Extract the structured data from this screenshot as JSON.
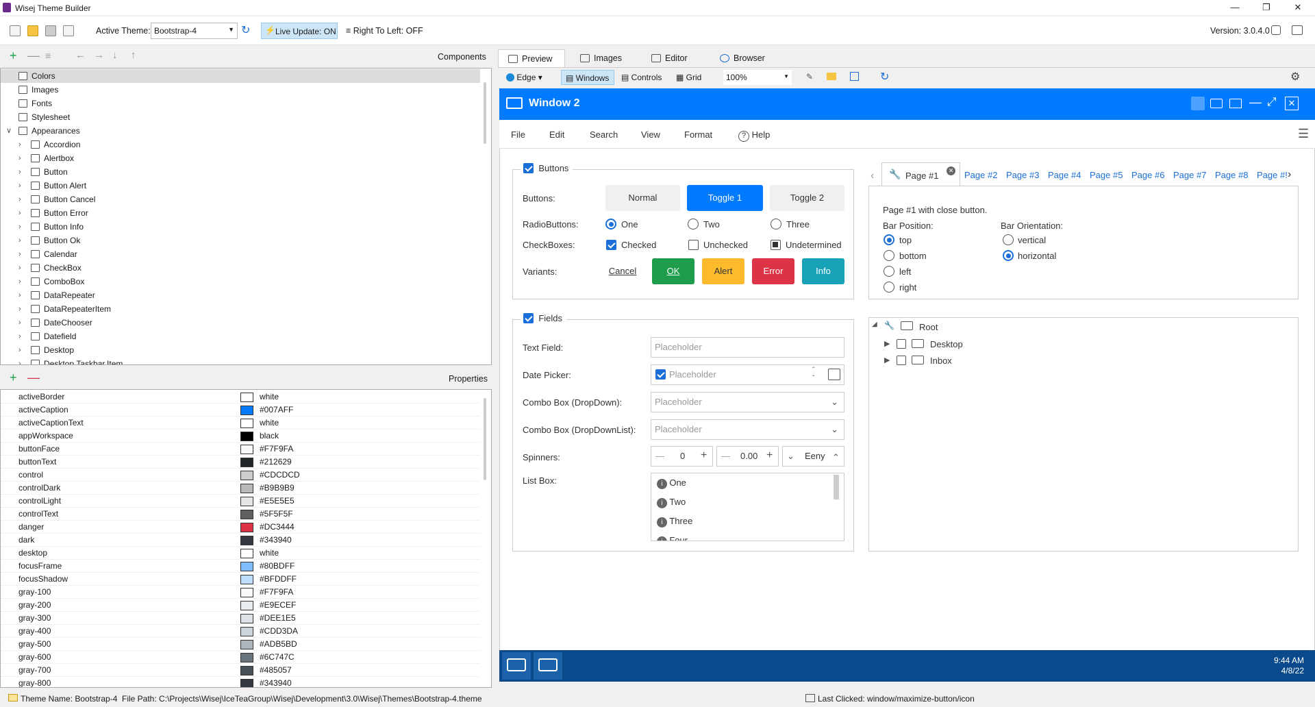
{
  "app": {
    "title": "Wisej Theme Builder",
    "version": "Version: 3.0.4.0"
  },
  "toolbar": {
    "active_theme_label": "Active Theme:",
    "active_theme_value": "Bootstrap-4",
    "live_update": "Live Update: ON",
    "rtl": "Right To Left: OFF"
  },
  "components": {
    "header": "Components",
    "items": [
      {
        "label": "Colors",
        "level": 0,
        "expandable": false,
        "selected": true
      },
      {
        "label": "Images",
        "level": 0,
        "expandable": false
      },
      {
        "label": "Fonts",
        "level": 0,
        "expandable": false
      },
      {
        "label": "Stylesheet",
        "level": 0,
        "expandable": false
      },
      {
        "label": "Appearances",
        "level": 0,
        "expandable": true,
        "expanded": true
      },
      {
        "label": "Accordion",
        "level": 1,
        "expandable": true
      },
      {
        "label": "Alertbox",
        "level": 1,
        "expandable": true
      },
      {
        "label": "Button",
        "level": 1,
        "expandable": true
      },
      {
        "label": "Button Alert",
        "level": 1,
        "expandable": true
      },
      {
        "label": "Button Cancel",
        "level": 1,
        "expandable": true
      },
      {
        "label": "Button Error",
        "level": 1,
        "expandable": true
      },
      {
        "label": "Button Info",
        "level": 1,
        "expandable": true
      },
      {
        "label": "Button Ok",
        "level": 1,
        "expandable": true
      },
      {
        "label": "Calendar",
        "level": 1,
        "expandable": true
      },
      {
        "label": "CheckBox",
        "level": 1,
        "expandable": true
      },
      {
        "label": "ComboBox",
        "level": 1,
        "expandable": true
      },
      {
        "label": "DataRepeater",
        "level": 1,
        "expandable": true
      },
      {
        "label": "DataRepeaterItem",
        "level": 1,
        "expandable": true
      },
      {
        "label": "DateChooser",
        "level": 1,
        "expandable": true
      },
      {
        "label": "Datefield",
        "level": 1,
        "expandable": true
      },
      {
        "label": "Desktop",
        "level": 1,
        "expandable": true
      },
      {
        "label": "Desktop.Taskbar.Item",
        "level": 1,
        "expandable": true
      }
    ]
  },
  "properties": {
    "header": "Properties",
    "rows": [
      {
        "name": "activeBorder",
        "color": "#FFFFFF",
        "value": "white"
      },
      {
        "name": "activeCaption",
        "color": "#007AFF",
        "value": "#007AFF"
      },
      {
        "name": "activeCaptionText",
        "color": "#FFFFFF",
        "value": "white"
      },
      {
        "name": "appWorkspace",
        "color": "#000000",
        "value": "black"
      },
      {
        "name": "buttonFace",
        "color": "#F7F9FA",
        "value": "#F7F9FA"
      },
      {
        "name": "buttonText",
        "color": "#212629",
        "value": "#212629"
      },
      {
        "name": "control",
        "color": "#CDCDCD",
        "value": "#CDCDCD"
      },
      {
        "name": "controlDark",
        "color": "#B9B9B9",
        "value": "#B9B9B9"
      },
      {
        "name": "controlLight",
        "color": "#E5E5E5",
        "value": "#E5E5E5"
      },
      {
        "name": "controlText",
        "color": "#5F5F5F",
        "value": "#5F5F5F"
      },
      {
        "name": "danger",
        "color": "#DC3444",
        "value": "#DC3444"
      },
      {
        "name": "dark",
        "color": "#343940",
        "value": "#343940"
      },
      {
        "name": "desktop",
        "color": "#FFFFFF",
        "value": "white"
      },
      {
        "name": "focusFrame",
        "color": "#80BDFF",
        "value": "#80BDFF"
      },
      {
        "name": "focusShadow",
        "color": "#BFDDFF",
        "value": "#BFDDFF"
      },
      {
        "name": "gray-100",
        "color": "#F7F9FA",
        "value": "#F7F9FA"
      },
      {
        "name": "gray-200",
        "color": "#E9ECEF",
        "value": "#E9ECEF"
      },
      {
        "name": "gray-300",
        "color": "#DEE1E5",
        "value": "#DEE1E5"
      },
      {
        "name": "gray-400",
        "color": "#CDD3DA",
        "value": "#CDD3DA"
      },
      {
        "name": "gray-500",
        "color": "#ADB5BD",
        "value": "#ADB5BD"
      },
      {
        "name": "gray-600",
        "color": "#6C747C",
        "value": "#6C747C"
      },
      {
        "name": "gray-700",
        "color": "#485057",
        "value": "#485057"
      },
      {
        "name": "gray-800",
        "color": "#343940",
        "value": "#343940"
      }
    ]
  },
  "tabs": [
    "Preview",
    "Images",
    "Editor",
    "Browser"
  ],
  "preview_toolbar": {
    "browser": "Edge",
    "windows": "Windows",
    "controls": "Controls",
    "grid": "Grid",
    "zoom": "100%"
  },
  "window": {
    "title": "Window 2",
    "menu": [
      "File",
      "Edit",
      "Search",
      "View",
      "Format",
      "Help"
    ],
    "buttons_group": {
      "title": "Buttons",
      "buttons_label": "Buttons:",
      "normal": "Normal",
      "toggle1": "Toggle 1",
      "toggle2": "Toggle 2",
      "radio_label": "RadioButtons:",
      "radios": [
        "One",
        "Two",
        "Three"
      ],
      "check_label": "CheckBoxes:",
      "checks": [
        "Checked",
        "Unchecked",
        "Undetermined"
      ],
      "variants_label": "Variants:",
      "cancel": "Cancel",
      "ok": "OK",
      "alert": "Alert",
      "error": "Error",
      "info": "Info"
    },
    "page_tabs": [
      "Page #1",
      "Page #2",
      "Page #3",
      "Page #4",
      "Page #5",
      "Page #6",
      "Page #7",
      "Page #8",
      "Page #!"
    ],
    "page1": {
      "desc": "Page #1 with close button.",
      "bar_position_label": "Bar Position:",
      "positions": [
        "top",
        "bottom",
        "left",
        "right"
      ],
      "bar_orientation_label": "Bar Orientation:",
      "orientations": [
        "vertical",
        "horizontal"
      ]
    },
    "fields_group": {
      "title": "Fields",
      "text_field": "Text Field:",
      "date_picker": "Date Picker:",
      "combo_dropdown": "Combo Box (DropDown):",
      "combo_dropdownlist": "Combo Box (DropDownList):",
      "spinners": "Spinners:",
      "list_box": "List Box:",
      "placeholder": "Placeholder",
      "spin1": "0",
      "spin2": "0.00",
      "spin3": "Eeny",
      "list_items": [
        "One",
        "Two",
        "Three",
        "Four"
      ]
    },
    "tree": {
      "root": "Root",
      "children": [
        "Desktop",
        "Inbox"
      ]
    },
    "taskbar": {
      "time": "9:44 AM",
      "date": "4/8/22"
    }
  },
  "status": {
    "theme_name": "Theme Name: Bootstrap-4",
    "file_path": "File Path: C:\\Projects\\Wisej\\IceTeaGroup\\Wisej\\Development\\3.0\\Wisej\\Themes\\Bootstrap-4.theme",
    "last_clicked": "Last Clicked: window/maximize-button/icon"
  },
  "colors": {
    "accent": "#007AFF",
    "ok": "#1E9E4A",
    "alert": "#FDBA2C",
    "error": "#DC3444",
    "info": "#17A2B8",
    "taskbar": "#0A4A8C"
  }
}
